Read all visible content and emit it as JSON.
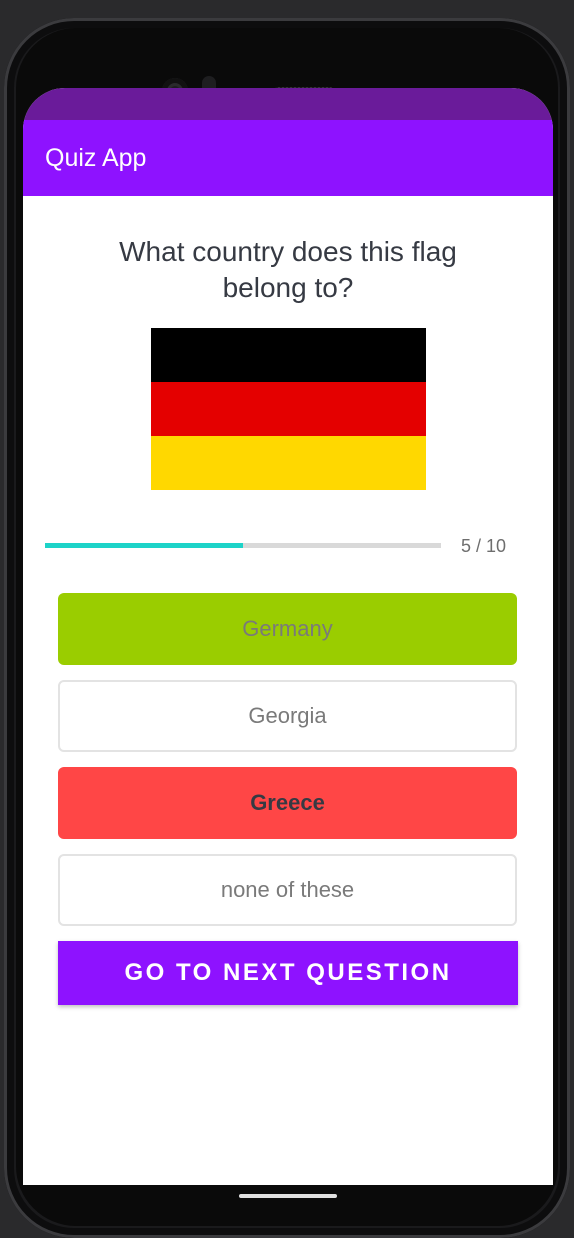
{
  "app": {
    "title": "Quiz App",
    "colors": {
      "status_bar": "#6a1b9a",
      "app_bar": "#8e12ff",
      "progress": "#1dd3c8",
      "correct": "#9acd00",
      "wrong": "#ff4646"
    }
  },
  "quiz": {
    "question": "What country does this flag belong to?",
    "flag": {
      "name": "germany-flag",
      "stripes": [
        "#000000",
        "#e40000",
        "#ffd800"
      ]
    },
    "progress": {
      "current": 5,
      "total": 10,
      "label": "5 / 10"
    },
    "options": [
      {
        "label": "Germany",
        "state": "correct",
        "bg": "#9acd00",
        "color": "#7a7a7a",
        "bold": false
      },
      {
        "label": "Georgia",
        "state": "default",
        "bg": "#ffffff",
        "color": "#7a7a7a",
        "bold": false
      },
      {
        "label": "Greece",
        "state": "wrong",
        "bg": "#ff4646",
        "color": "#363a43",
        "bold": true
      },
      {
        "label": "none of these",
        "state": "default",
        "bg": "#ffffff",
        "color": "#7a7a7a",
        "bold": false
      }
    ],
    "next_button": "GO TO NEXT QUESTION"
  }
}
